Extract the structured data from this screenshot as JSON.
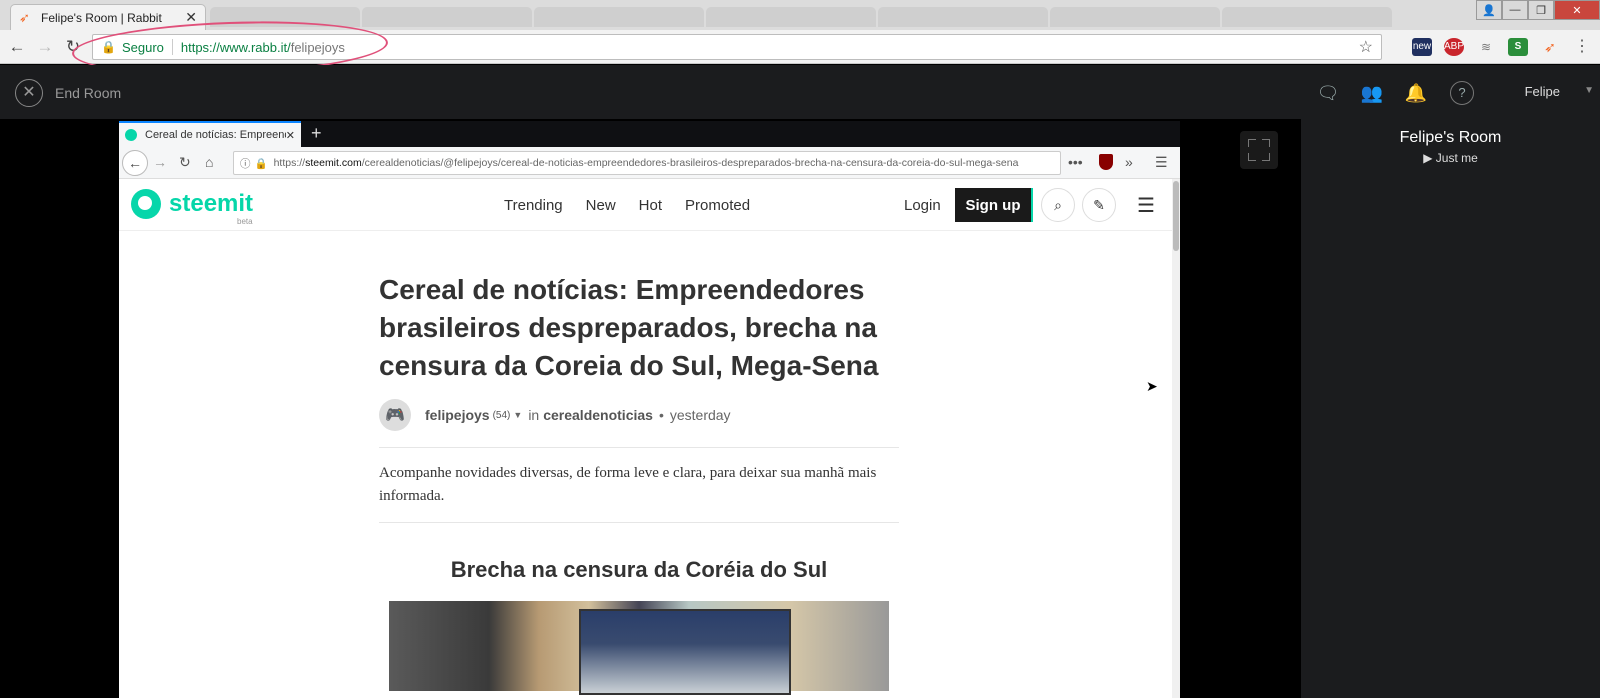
{
  "chrome": {
    "tab_title": "Felipe's Room | Rabbit",
    "secure_label": "Seguro",
    "url_main": "https://www.rabb.it/",
    "url_path": "felipejoys",
    "ext_new": "new",
    "ext_abp": "ABP"
  },
  "rabbit": {
    "end_room": "End Room",
    "user_name": "Felipe",
    "room_title": "Felipe's Room",
    "room_sub": "▶ Just me"
  },
  "firefox": {
    "tab_title": "Cereal de notícias: Empreend",
    "url_prefix": "https://",
    "url_host": "steemit.com",
    "url_path": "/cerealdenoticias/@felipejoys/cereal-de-noticias-empreendedores-brasileiros-despreparados-brecha-na-censura-da-coreia-do-sul-mega-sena"
  },
  "steemit": {
    "logo": "steemit",
    "beta": "beta",
    "nav": [
      "Trending",
      "New",
      "Hot",
      "Promoted"
    ],
    "login": "Login",
    "signup": "Sign up"
  },
  "article": {
    "title": "Cereal de notícias: Empreendedores brasileiros despreparados, brecha na censura da Coreia do Sul, Mega-Sena",
    "author": "felipejoys",
    "rep": "(54)",
    "in_label": "in",
    "category": "cerealdenoticias",
    "time": "yesterday",
    "summary": "Acompanhe novidades diversas, de forma leve e clara, para deixar sua manhã mais informada.",
    "section_title": "Brecha na censura da Coréia do Sul"
  }
}
